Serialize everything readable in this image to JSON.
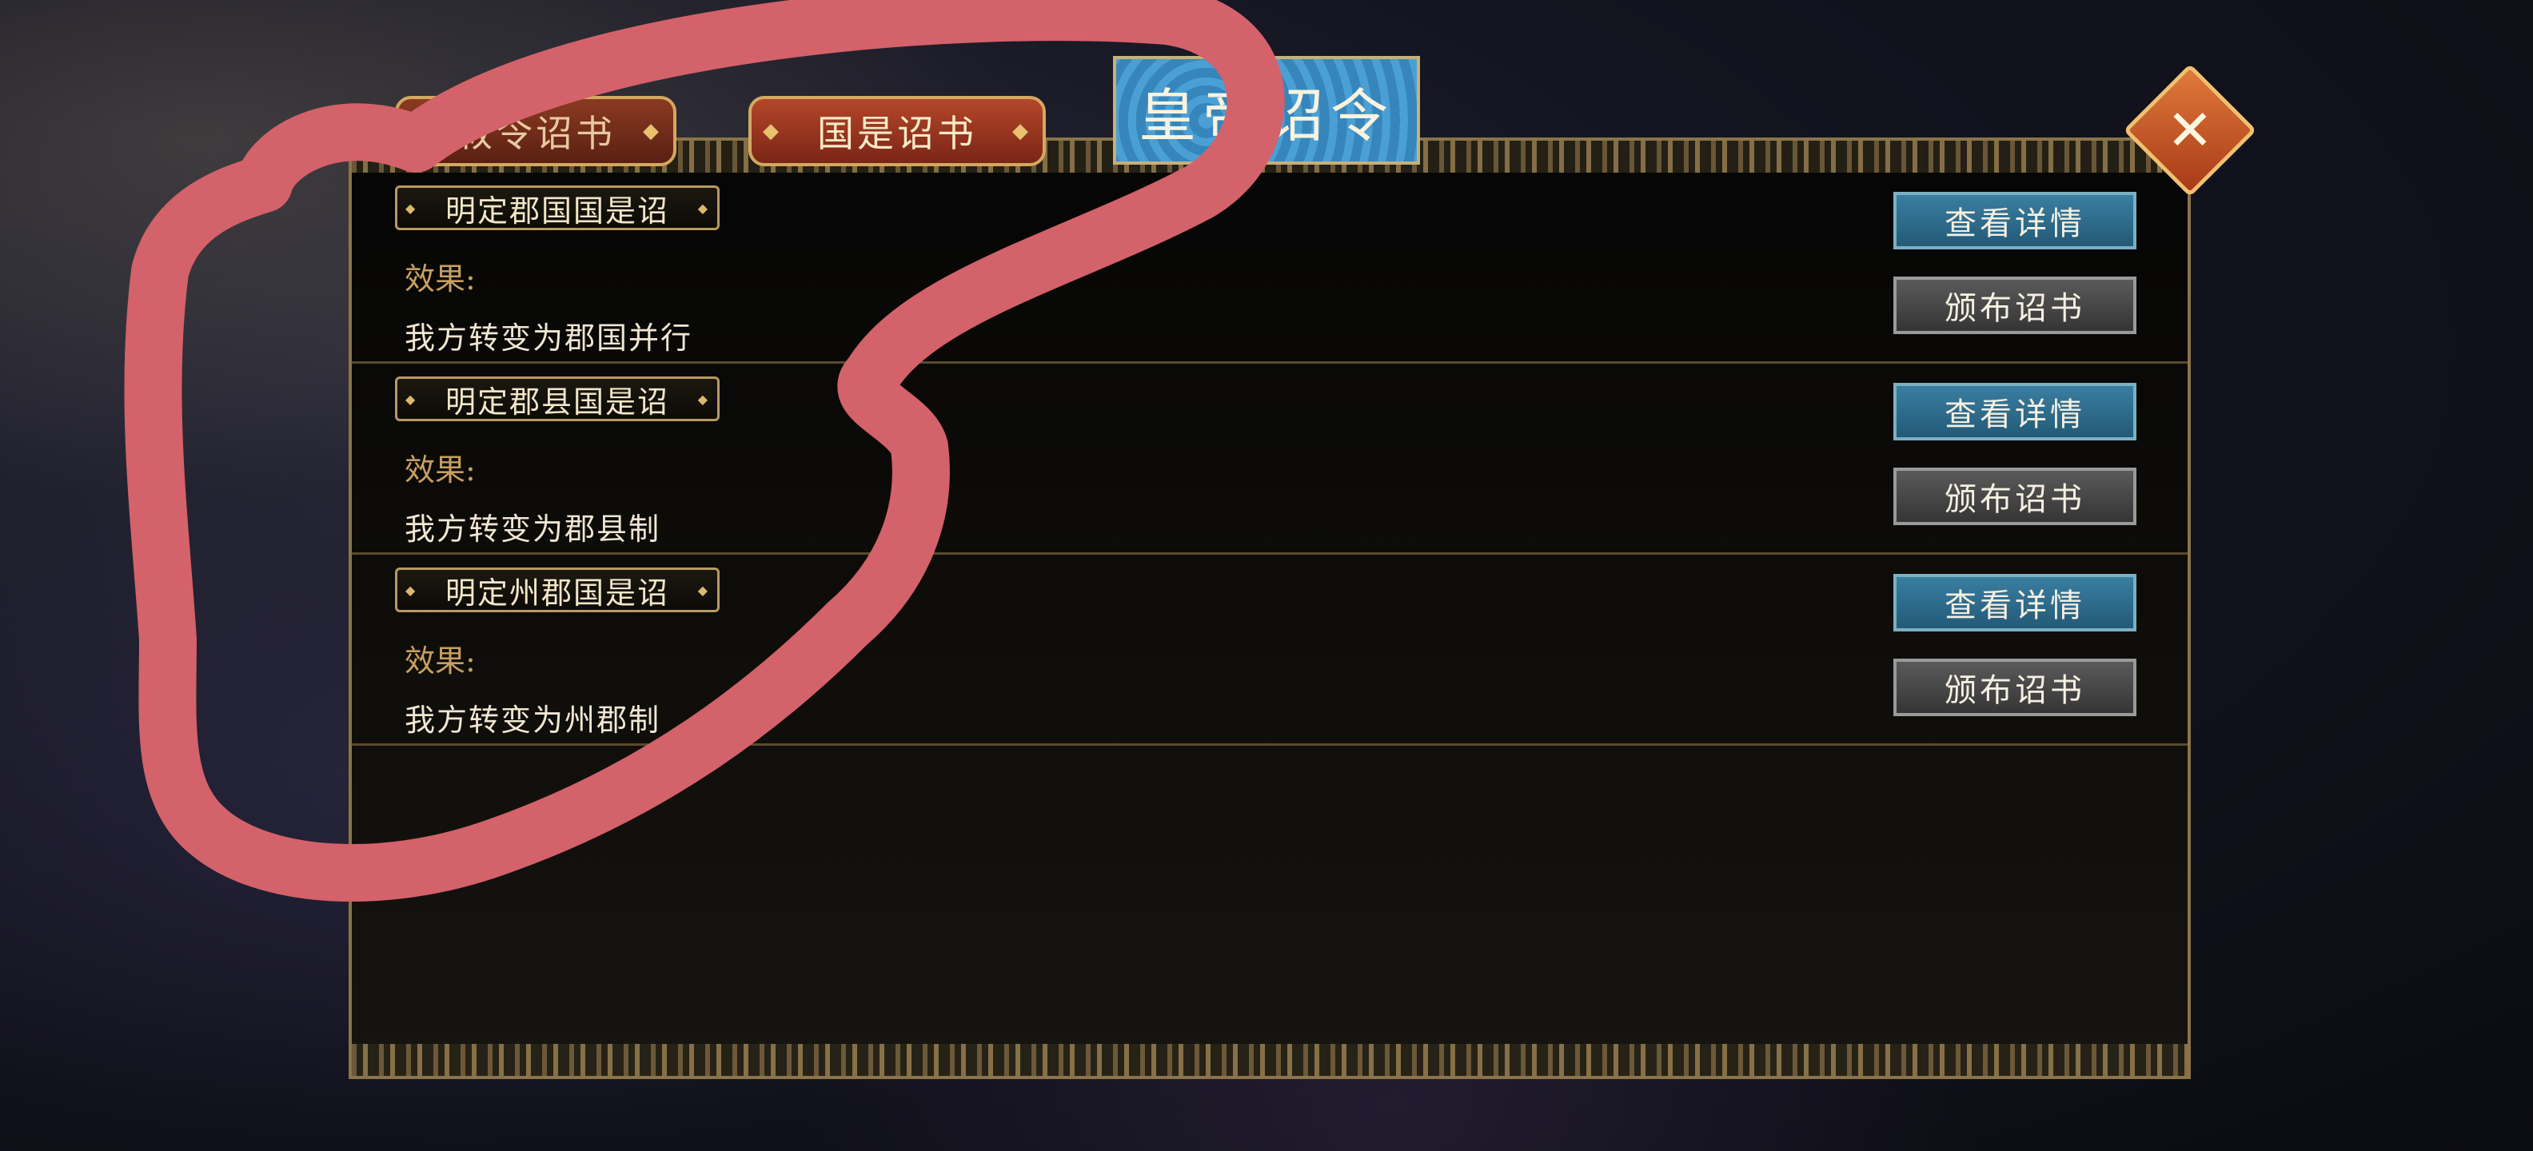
{
  "tabs": [
    {
      "label": "敕令诏书"
    },
    {
      "label": "国是诏书"
    }
  ],
  "active_tab": {
    "label": "皇帝诏令"
  },
  "close": {
    "icon": "close-icon"
  },
  "rows": [
    {
      "title": "明定郡国国是诏",
      "effect_label": "效果:",
      "effect": "我方转变为郡国并行",
      "detail_btn": "查看详情",
      "issue_btn": "颁布诏书"
    },
    {
      "title": "明定郡县国是诏",
      "effect_label": "效果:",
      "effect": "我方转变为郡县制",
      "detail_btn": "查看详情",
      "issue_btn": "颁布诏书"
    },
    {
      "title": "明定州郡国是诏",
      "effect_label": "效果:",
      "effect": "我方转变为州郡制",
      "detail_btn": "查看详情",
      "issue_btn": "颁布诏书"
    }
  ],
  "colors": {
    "accent_gold": "#c8a060",
    "detail_button": "#2e6c8c",
    "issue_button": "#474747",
    "tab_red": "#9a3a20",
    "annotation_stroke": "#d4626a"
  }
}
